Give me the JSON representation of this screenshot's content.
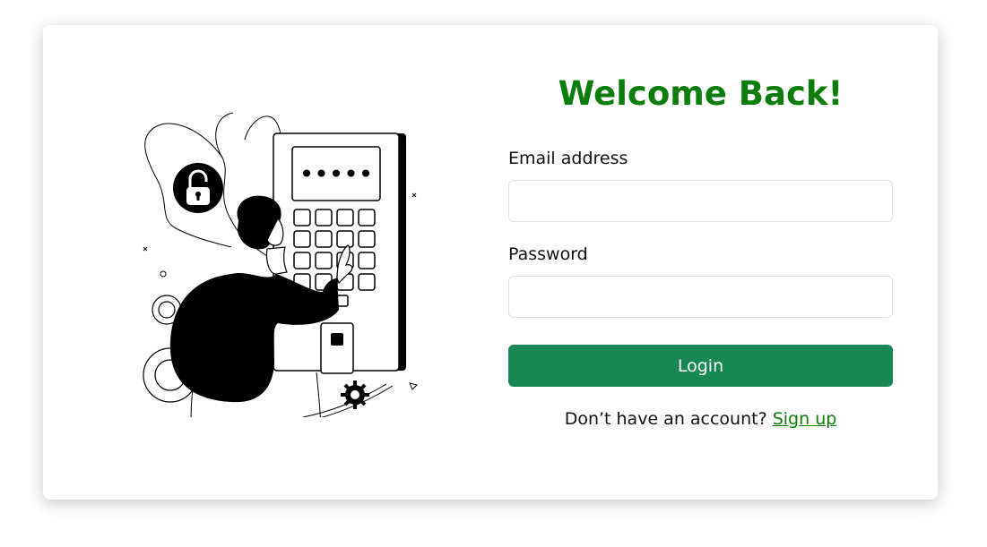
{
  "colors": {
    "title": "#0b7d0b",
    "button": "#198754",
    "link": "#0b7d0b"
  },
  "login": {
    "title": "Welcome Back!",
    "email_label": "Email address",
    "email_value": "",
    "password_label": "Password",
    "password_value": "",
    "button_label": "Login",
    "signup_prompt": "Don’t have an account?",
    "signup_link": "Sign up"
  },
  "illustration": {
    "keypad_display": "•••••",
    "icons": [
      "padlock-icon",
      "gear-icon",
      "keypad-icon",
      "person-icon"
    ]
  }
}
